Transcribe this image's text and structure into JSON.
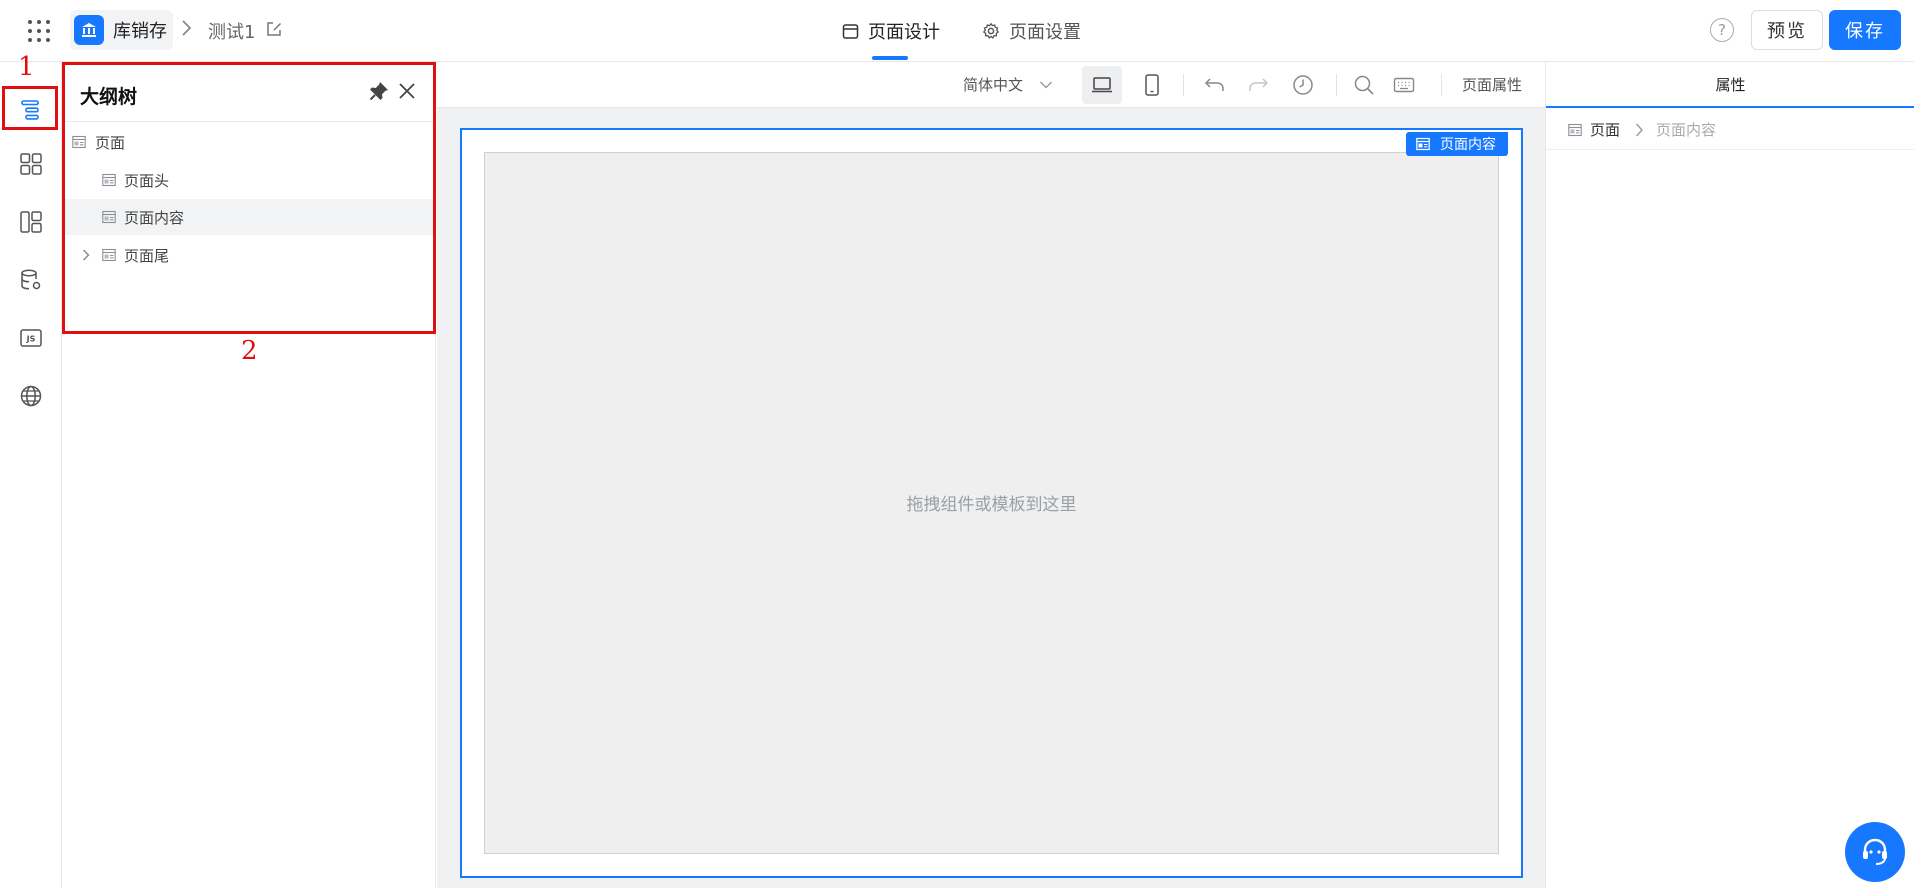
{
  "topbar": {
    "app_name": "库销存",
    "page_name": "测试1",
    "tabs": [
      {
        "label": "页面设计",
        "active": true
      },
      {
        "label": "页面设置",
        "active": false
      }
    ],
    "help_symbol": "?",
    "preview_label": "预览",
    "save_label": "保存"
  },
  "rail": {
    "items": [
      "outline-tree-icon",
      "components-grid-icon",
      "layout-template-icon",
      "database-settings-icon",
      "js-code-icon",
      "globe-icon"
    ]
  },
  "annotations": {
    "label_1": "1",
    "label_2": "2"
  },
  "outline": {
    "title": "大纲树",
    "tree": [
      {
        "label": "页面"
      },
      {
        "label": "页面头"
      },
      {
        "label": "页面内容",
        "selected": true
      },
      {
        "label": "页面尾",
        "expandable": true
      }
    ]
  },
  "canvas": {
    "language": "简体中文",
    "page_props_label": "页面属性",
    "selected_tag": "页面内容",
    "drop_hint": "拖拽组件或模板到这里"
  },
  "props_panel": {
    "tab_label": "属性",
    "breadcrumb": [
      "页面",
      "页面内容"
    ]
  },
  "colors": {
    "accent": "#1677ff",
    "annotation": "#e01010"
  }
}
